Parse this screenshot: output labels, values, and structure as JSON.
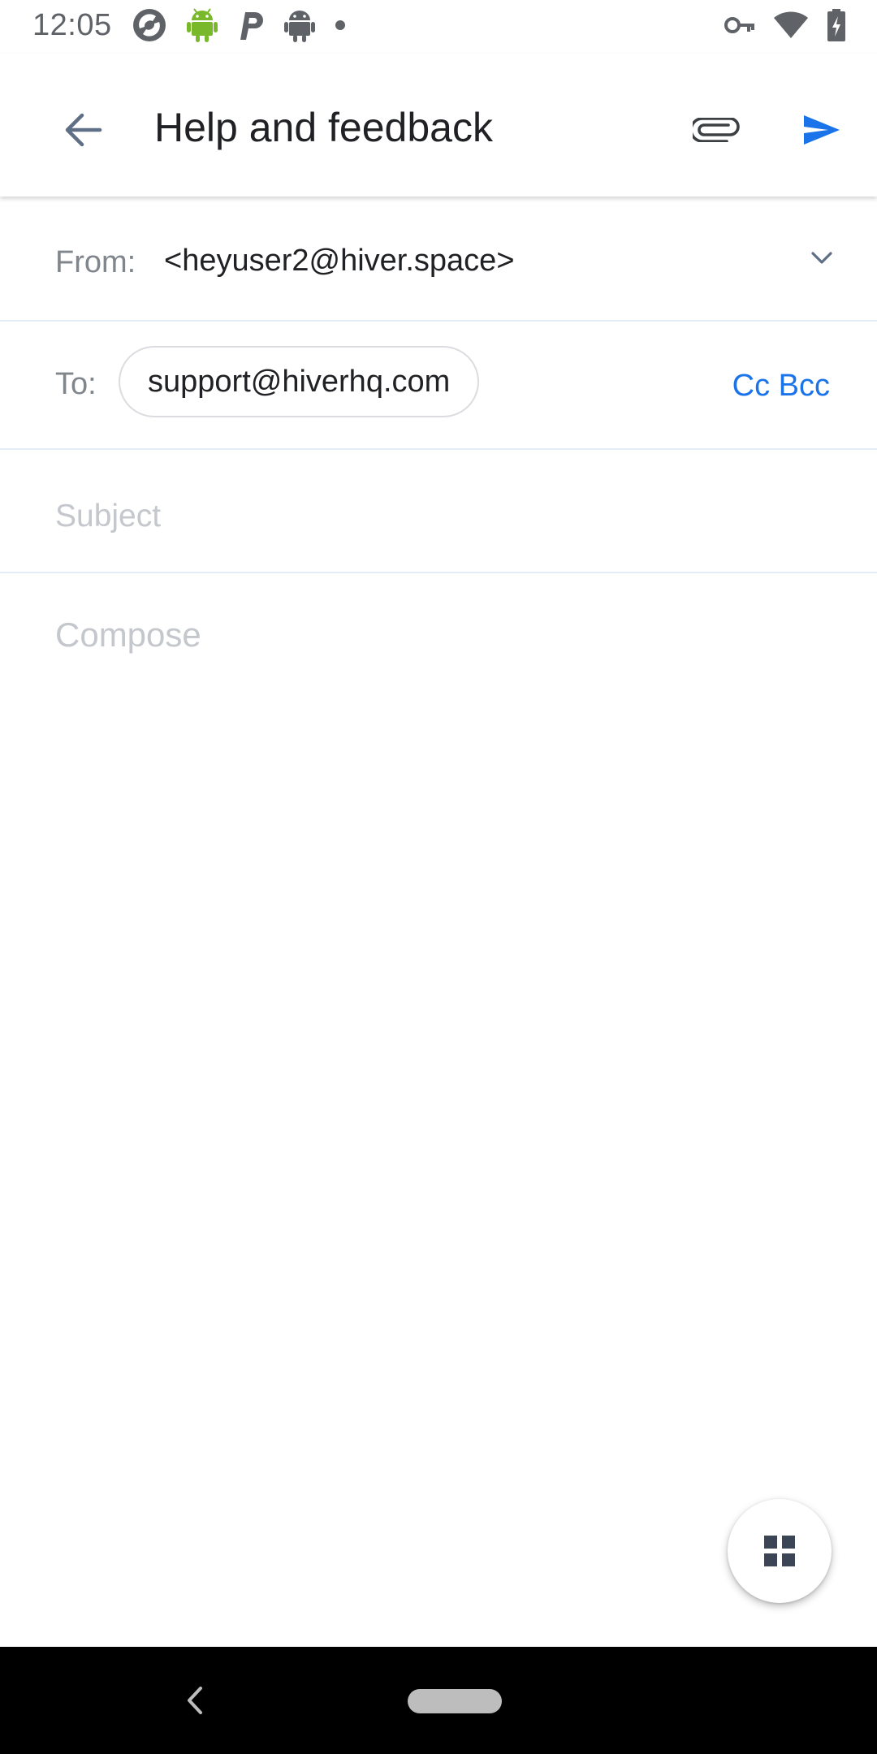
{
  "status_bar": {
    "time": "12:05",
    "left_icons": [
      "sync-app-icon",
      "android-debug-icon",
      "parking-app-icon",
      "android-icon",
      "notification-dot-icon"
    ],
    "right_icons": [
      "vpn-key-icon",
      "wifi-icon",
      "battery-charging-icon"
    ]
  },
  "toolbar": {
    "title": "Help and feedback",
    "back_icon": "arrow-back-icon",
    "attach_icon": "paperclip-icon",
    "send_icon": "send-icon",
    "accent_color": "#1a73e8"
  },
  "form": {
    "from_label": "From:",
    "from_value": "<heyuser2@hiver.space>",
    "to_label": "To:",
    "to_recipient": "support@hiverhq.com",
    "cc_bcc_label": "Cc Bcc",
    "subject_placeholder": "Subject",
    "subject_value": "",
    "compose_placeholder": "Compose",
    "compose_value": ""
  },
  "fab": {
    "icon": "grid-apps-icon"
  },
  "nav_bar": {
    "back_icon": "nav-back-icon",
    "home_icon": "home-pill-icon"
  }
}
